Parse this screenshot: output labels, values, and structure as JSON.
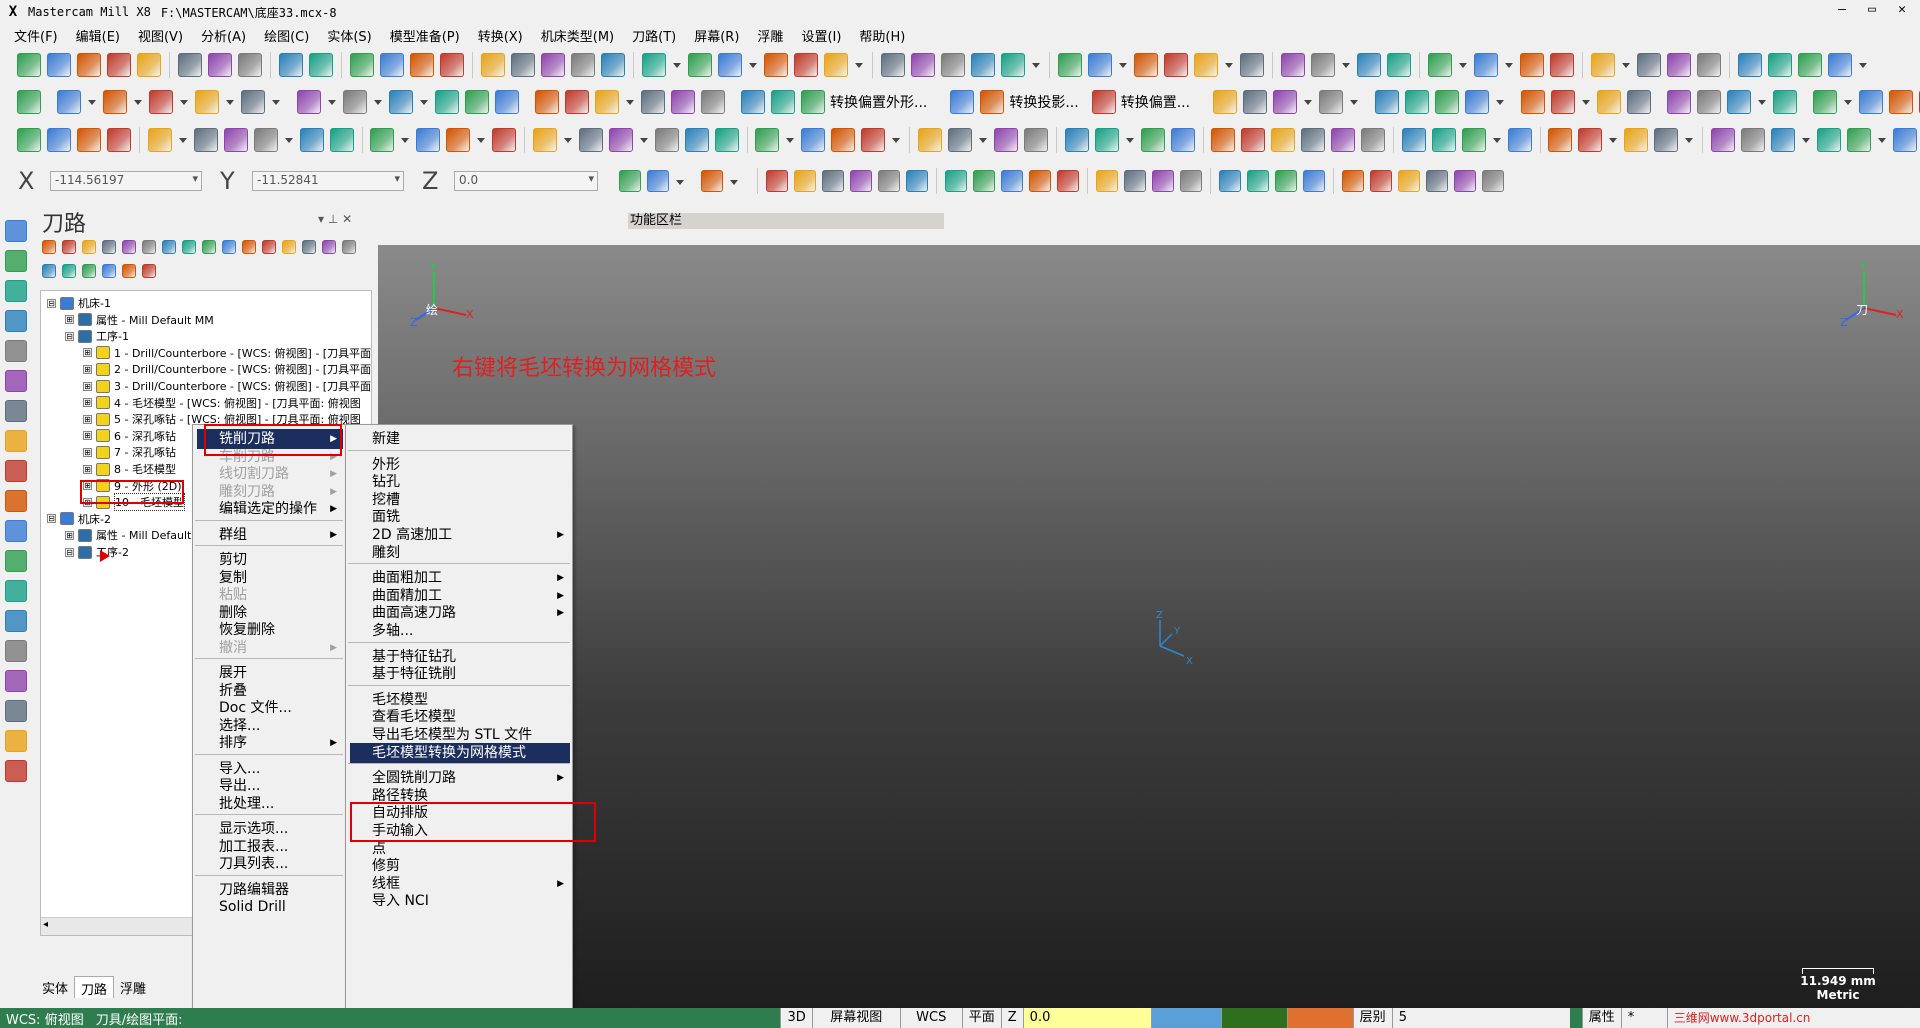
{
  "title": {
    "app": "Mastercam Mill X8",
    "file": "F:\\MASTERCAM\\底座33.mcx-8"
  },
  "window_controls": {
    "minimize": "–",
    "restore": "▭",
    "close": "✕"
  },
  "menubar": [
    "文件(F)",
    "编辑(E)",
    "视图(V)",
    "分析(A)",
    "绘图(C)",
    "实体(S)",
    "模型准备(P)",
    "转换(X)",
    "机床类型(M)",
    "刀路(T)",
    "屏幕(R)",
    "浮雕",
    "设置(I)",
    "帮助(H)"
  ],
  "toolbar2_labels": {
    "offset_contour": "转换偏置外形...",
    "projection": "转换投影...",
    "offset": "转换偏置..."
  },
  "coords": {
    "x_label": "X",
    "x_value": "-114.56197",
    "y_label": "Y",
    "y_value": "-11.52841",
    "z_label": "Z",
    "z_value": "0.0"
  },
  "panel": {
    "title": "刀路",
    "pin": "▾ ⊥ ✕"
  },
  "tree": [
    {
      "level": 0,
      "expander": "⊟",
      "label": "机床-1"
    },
    {
      "level": 1,
      "expander": "⊞",
      "label": "属性 - Mill Default MM"
    },
    {
      "level": 1,
      "expander": "⊟",
      "label": "工序-1"
    },
    {
      "level": 2,
      "expander": "⊞",
      "label": "1 - Drill/Counterbore - [WCS: 俯视图] - [刀具平面:"
    },
    {
      "level": 2,
      "expander": "⊞",
      "label": "2 - Drill/Counterbore - [WCS: 俯视图] - [刀具平面:"
    },
    {
      "level": 2,
      "expander": "⊞",
      "label": "3 - Drill/Counterbore - [WCS: 俯视图] - [刀具平面:"
    },
    {
      "level": 2,
      "expander": "⊞",
      "label": "4 - 毛坯模型 - [WCS: 俯视图] - [刀具平面: 俯视图"
    },
    {
      "level": 2,
      "expander": "⊞",
      "label": "5 - 深孔啄钻 - [WCS: 俯视图] - [刀具平面: 俯视图"
    },
    {
      "level": 2,
      "expander": "⊞",
      "label": "6 - 深孔啄钻"
    },
    {
      "level": 2,
      "expander": "⊞",
      "label": "7 - 深孔啄钻"
    },
    {
      "level": 2,
      "expander": "⊞",
      "label": "8 - 毛坯模型"
    },
    {
      "level": 2,
      "expander": "⊞",
      "label": "9 - 外形 (2D)"
    },
    {
      "level": 2,
      "expander": "⊞",
      "label": "10 - 毛坯模型"
    },
    {
      "level": 0,
      "expander": "⊟",
      "label": "机床-2"
    },
    {
      "level": 1,
      "expander": "⊞",
      "label": "属性 - Mill Default"
    },
    {
      "level": 1,
      "expander": "⊟",
      "label": "工序-2"
    }
  ],
  "tabs": [
    "实体",
    "刀路",
    "浮雕"
  ],
  "function_bar": "功能区栏",
  "annotation": "右键将毛坯转换为网格模式",
  "viewport_labels": {
    "left_gnomon": "绘",
    "right_gnomon": "刀",
    "x": "X",
    "y": "Y",
    "z": "Z"
  },
  "scale": {
    "value": "11.949 mm",
    "unit": "Metric"
  },
  "context_menu": [
    {
      "label": "铣削刀路",
      "submenu": true,
      "state": "highlight"
    },
    {
      "label": "车削刀路",
      "submenu": true,
      "state": "disabled"
    },
    {
      "label": "线切割刀路",
      "submenu": true,
      "state": "disabled"
    },
    {
      "label": "雕刻刀路",
      "submenu": true,
      "state": "disabled"
    },
    {
      "label": "编辑选定的操作",
      "submenu": true,
      "state": "normal"
    },
    {
      "sep": true
    },
    {
      "label": "群组",
      "submenu": true,
      "state": "normal"
    },
    {
      "sep": true
    },
    {
      "label": "剪切",
      "state": "normal"
    },
    {
      "label": "复制",
      "state": "normal"
    },
    {
      "label": "粘贴",
      "state": "disabled"
    },
    {
      "label": "删除",
      "state": "normal"
    },
    {
      "label": "恢复删除",
      "state": "normal"
    },
    {
      "label": "撤消",
      "submenu": true,
      "state": "disabled"
    },
    {
      "sep": true
    },
    {
      "label": "展开",
      "state": "normal"
    },
    {
      "label": "折叠",
      "state": "normal"
    },
    {
      "label": "Doc 文件...",
      "state": "normal"
    },
    {
      "label": "选择...",
      "state": "normal"
    },
    {
      "label": "排序",
      "submenu": true,
      "state": "normal"
    },
    {
      "sep": true
    },
    {
      "label": "导入...",
      "state": "normal"
    },
    {
      "label": "导出...",
      "state": "normal"
    },
    {
      "label": "批处理...",
      "state": "normal"
    },
    {
      "sep": true
    },
    {
      "label": "显示选项...",
      "state": "normal"
    },
    {
      "label": "加工报表...",
      "state": "normal"
    },
    {
      "label": "刀具列表...",
      "state": "normal"
    },
    {
      "sep": true
    },
    {
      "label": "刀路编辑器",
      "state": "normal"
    },
    {
      "label": "Solid Drill",
      "state": "normal"
    }
  ],
  "submenu": [
    {
      "label": "新建",
      "state": "normal"
    },
    {
      "sep": true
    },
    {
      "label": "外形",
      "state": "normal"
    },
    {
      "label": "钻孔",
      "state": "normal"
    },
    {
      "label": "挖槽",
      "state": "normal"
    },
    {
      "label": "面铣",
      "state": "normal"
    },
    {
      "label": "2D 高速加工",
      "submenu": true,
      "state": "normal"
    },
    {
      "label": "雕刻",
      "state": "normal"
    },
    {
      "sep": true
    },
    {
      "label": "曲面粗加工",
      "submenu": true,
      "state": "normal"
    },
    {
      "label": "曲面精加工",
      "submenu": true,
      "state": "normal"
    },
    {
      "label": "曲面高速刀路",
      "submenu": true,
      "state": "normal"
    },
    {
      "label": "多轴...",
      "state": "normal"
    },
    {
      "sep": true
    },
    {
      "label": "基于特征钻孔",
      "state": "normal"
    },
    {
      "label": "基于特征铣削",
      "state": "normal"
    },
    {
      "sep": true
    },
    {
      "label": "毛坯模型",
      "state": "normal"
    },
    {
      "label": "查看毛坯模型",
      "state": "normal"
    },
    {
      "label": "导出毛坯模型为 STL 文件",
      "state": "normal"
    },
    {
      "label": "毛坯模型转换为网格模式",
      "state": "highlight"
    },
    {
      "sep": true
    },
    {
      "label": "全圆铣削刀路",
      "submenu": true,
      "state": "normal"
    },
    {
      "label": "路径转换",
      "state": "normal"
    },
    {
      "label": "自动排版",
      "state": "normal"
    },
    {
      "label": "手动输入",
      "state": "normal"
    },
    {
      "label": "点",
      "state": "normal"
    },
    {
      "label": "修剪",
      "state": "normal"
    },
    {
      "label": "线框",
      "submenu": true,
      "state": "normal"
    },
    {
      "label": "导入 NCI",
      "state": "normal"
    }
  ],
  "statusbar": {
    "wcs_view": "WCS: 俯视图",
    "tool_plane": "刀具/绘图平面:",
    "btn_3d": "3D",
    "screen_view": "屏幕视图",
    "wcs": "WCS",
    "plane": "平面",
    "z_label": "Z",
    "z_value": "0.0",
    "level_label": "层别",
    "level_value": "5",
    "attr_label": "属性",
    "star": "*",
    "watermark": "三维网www.3dportal.cn"
  },
  "colors": {
    "highlight": "#1c2e5e",
    "status_green": "#2e7d4f",
    "annotation_red": "#e02020"
  }
}
